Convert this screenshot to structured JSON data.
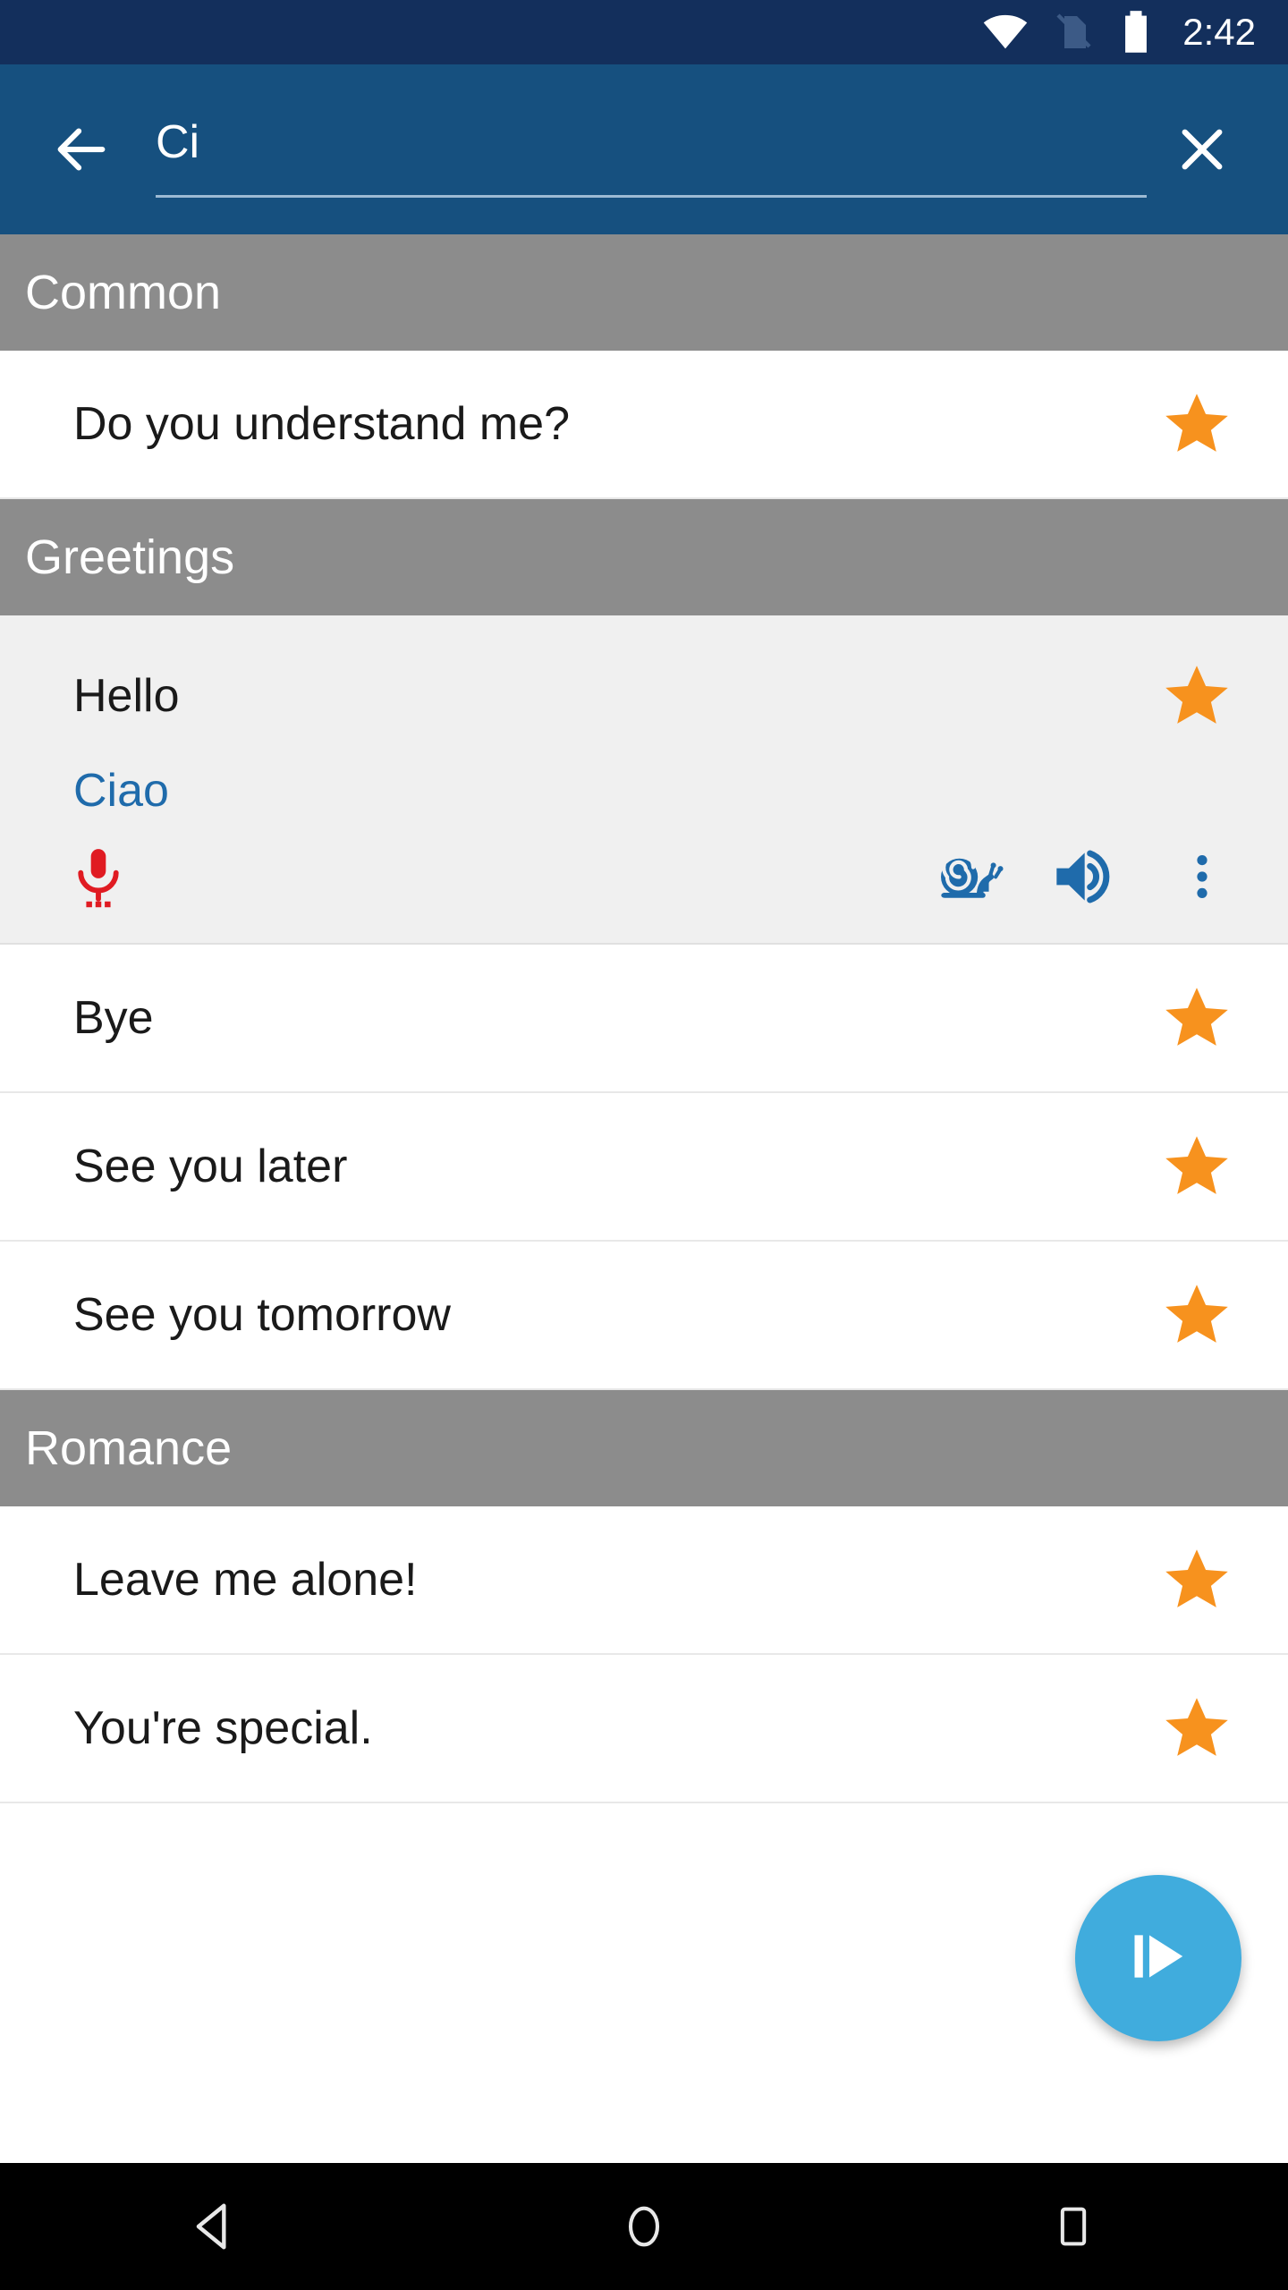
{
  "statusbar": {
    "time": "2:42",
    "icons": [
      "wifi-icon",
      "sim-off-icon",
      "battery-icon"
    ]
  },
  "appbar": {
    "back_icon": "back-arrow-icon",
    "search_value": "Ci",
    "search_placeholder": "Search",
    "clear_icon": "close-icon",
    "background_color": "#16507f"
  },
  "colors": {
    "status_bar": "#132f5c",
    "app_bar": "#16507f",
    "section_header": "#8c8c8c",
    "star": "#f7921e",
    "translation_text": "#1f6bab",
    "mic": "#e01b22",
    "action_icon": "#1f6bab",
    "fab": "#40acdd"
  },
  "sections": [
    {
      "title": "Common",
      "rows": [
        {
          "label": "Do you understand me?",
          "starred": true,
          "expanded": false
        }
      ]
    },
    {
      "title": "Greetings",
      "rows": [
        {
          "label": "Hello",
          "translation": "Ciao",
          "starred": true,
          "expanded": true,
          "actions": {
            "mic": "microphone-icon",
            "slow": "snail-icon",
            "speak": "speaker-icon",
            "more": "overflow-menu-icon"
          }
        },
        {
          "label": "Bye",
          "starred": true,
          "expanded": false
        },
        {
          "label": "See you later",
          "starred": true,
          "expanded": false
        },
        {
          "label": "See you tomorrow",
          "starred": true,
          "expanded": false
        }
      ]
    },
    {
      "title": "Romance",
      "rows": [
        {
          "label": "Leave me alone!",
          "starred": true,
          "expanded": false
        },
        {
          "label": "You're special.",
          "starred": true,
          "expanded": false
        }
      ]
    }
  ],
  "fab": {
    "icon": "play-from-here-icon"
  },
  "navbar": {
    "back": "nav-back-icon",
    "home": "nav-home-icon",
    "recents": "nav-recents-icon"
  }
}
